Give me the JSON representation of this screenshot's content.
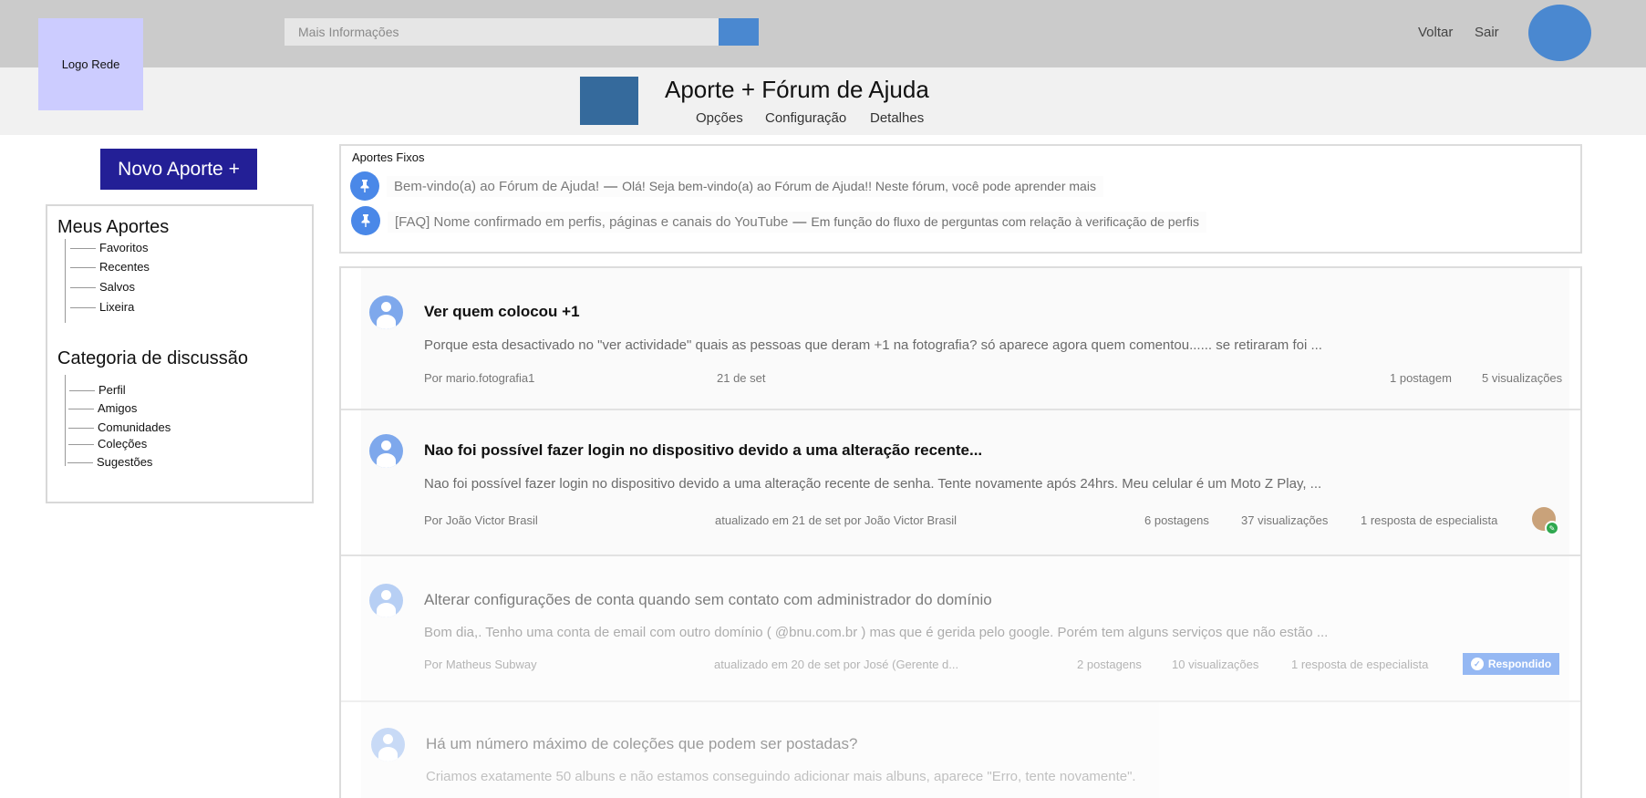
{
  "header": {
    "logo_text": "Logo Rede",
    "search_placeholder": "Mais Informações",
    "nav": {
      "back": "Voltar",
      "logout": "Sair"
    }
  },
  "forum": {
    "title": "Aporte + Fórum de Ajuda",
    "tabs": [
      "Opções",
      "Configuração",
      "Detalhes"
    ]
  },
  "sidebar": {
    "new_post_button": "Novo Aporte +",
    "my_posts_heading": "Meus Aportes",
    "my_posts_items": [
      "Favoritos",
      "Recentes",
      "Salvos",
      "Lixeira"
    ],
    "categories_heading": "Categoria de discussão",
    "categories_items": [
      "Perfil",
      "Amigos",
      "Comunidades",
      "Coleções",
      "Sugestões"
    ]
  },
  "pinned": {
    "heading": "Aportes Fixos",
    "items": [
      {
        "title": "Bem-vindo(a) ao Fórum de Ajuda!",
        "excerpt": "Olá! Seja bem-vindo(a) ao Fórum de Ajuda!! Neste fórum, você pode aprender mais"
      },
      {
        "title": "[FAQ] Nome confirmado em perfis, páginas e canais do YouTube",
        "excerpt": "Em função do fluxo de perguntas com relação à verificação de perfis"
      }
    ]
  },
  "posts": [
    {
      "title": "Ver quem colocou +1",
      "excerpt": "Porque esta desactivado no \"ver actividade\" quais as pessoas que deram +1 na fotografia? só aparece agora quem comentou...... se retiraram foi ...",
      "author": "Por mario.fotografia1",
      "date": "21 de set",
      "replies": "1 postagem",
      "views": "5 visualizações"
    },
    {
      "title": "Nao foi possível fazer login no dispositivo devido a uma alteração recente...",
      "excerpt": "Nao foi possível fazer login no dispositivo devido a uma alteração recente de senha. Tente novamente após 24hrs. Meu celular é um Moto Z Play, ...",
      "author": "Por João Victor Brasil",
      "date": "atualizado em 21 de set por João Victor Brasil",
      "replies": "6 postagens",
      "views": "37 visualizações",
      "expert": "1 resposta de especialista"
    },
    {
      "title": "Alterar configurações de conta quando sem contato com administrador do domínio",
      "excerpt": "Bom dia,. Tenho uma conta de email com outro domínio ( @bnu.com.br ) mas que é gerida pelo google. Porém tem alguns serviços que não estão ...",
      "author": "Por Matheus Subway",
      "date": "atualizado em 20 de set por José (Gerente d...",
      "replies": "2 postagens",
      "views": "10 visualizações",
      "expert": "1 resposta de especialista",
      "status": "Respondido"
    },
    {
      "title": "Há um número máximo de coleções que podem ser postadas?",
      "excerpt": "Criamos exatamente 50 albuns e não estamos conseguindo adicionar mais albuns, aparece \"Erro, tente novamente\"."
    }
  ],
  "colors": {
    "topbar": "#cbcbcb",
    "accent_blue": "#4a88d0",
    "new_post_button": "#231f96",
    "forum_icon": "#356a9c",
    "logo_bg": "#ccccff"
  }
}
